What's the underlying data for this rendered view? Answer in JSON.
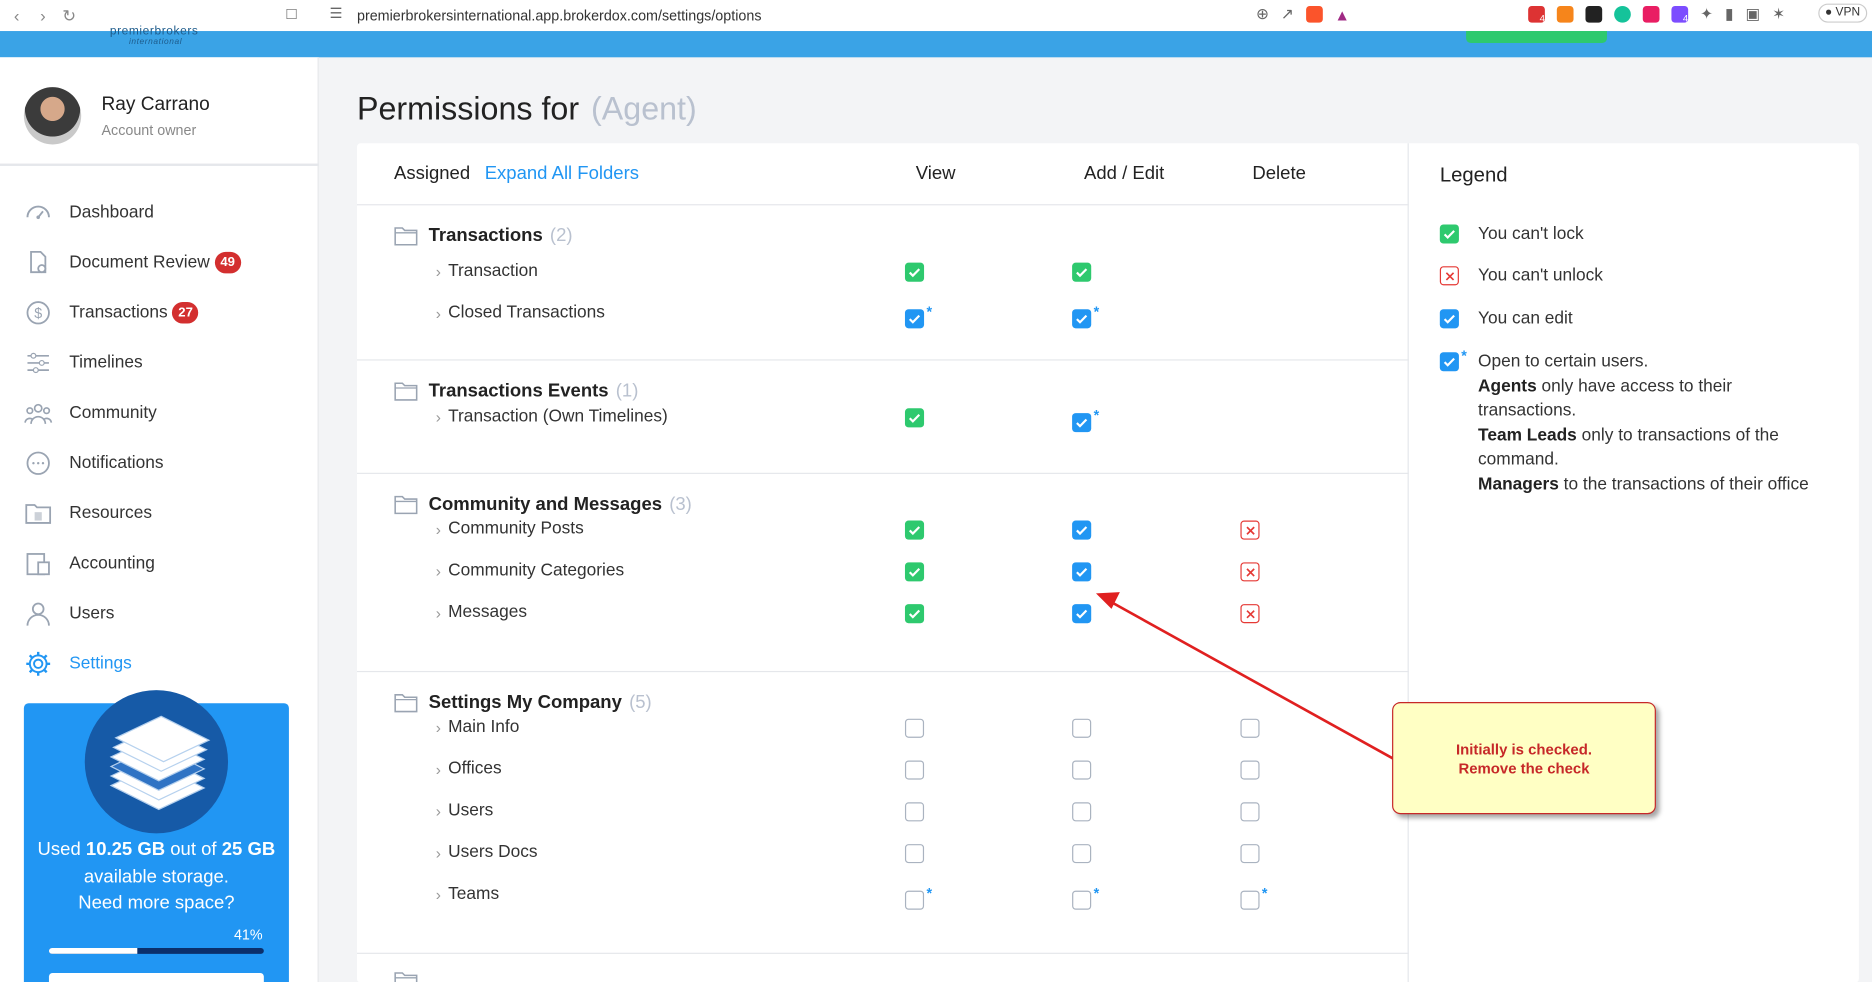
{
  "browser": {
    "url": "premierbrokersinternational.app.brokerdox.com/settings/options",
    "vpn_label": "VPN",
    "ext_badges": [
      "4",
      "4"
    ]
  },
  "brand": {
    "name": "premierbrokers",
    "sub": "international"
  },
  "user": {
    "name": "Ray Carrano",
    "role": "Account owner"
  },
  "sidebar": {
    "items": [
      {
        "label": "Dashboard",
        "icon": "dashboard-icon"
      },
      {
        "label": "Document Review",
        "badge": "49",
        "icon": "document-review-icon"
      },
      {
        "label": "Transactions",
        "badge": "27",
        "icon": "dollar-icon"
      },
      {
        "label": "Timelines",
        "icon": "timelines-icon"
      },
      {
        "label": "Community",
        "icon": "community-icon"
      },
      {
        "label": "Notifications",
        "icon": "chat-bubble-icon"
      },
      {
        "label": "Resources",
        "icon": "folder-icon"
      },
      {
        "label": "Accounting",
        "icon": "accounting-icon"
      },
      {
        "label": "Users",
        "icon": "user-icon"
      },
      {
        "label": "Settings",
        "icon": "gear-icon",
        "active": true
      }
    ]
  },
  "storage": {
    "used_prefix": "Used ",
    "used": "10.25 GB",
    "mid": " out of ",
    "total": "25 GB",
    "suffix": " available storage.",
    "cta": "Need more space?",
    "percent_label": "41%",
    "percent": 41
  },
  "page": {
    "title": "Permissions for",
    "role": "(Agent)"
  },
  "table": {
    "assigned_label": "Assigned",
    "expand_label": "Expand All Folders",
    "columns": [
      "View",
      "Add / Edit",
      "Delete"
    ],
    "folders": [
      {
        "name": "Transactions",
        "count": "(2)",
        "items": [
          {
            "label": "Transaction",
            "view": "green",
            "edit": "green",
            "del": "none"
          },
          {
            "label": "Closed Transactions",
            "view": "blue*",
            "edit": "blue*",
            "del": "none"
          }
        ]
      },
      {
        "name": "Transactions Events",
        "count": "(1)",
        "items": [
          {
            "label": "Transaction (Own Timelines)",
            "view": "green",
            "edit": "blue*",
            "del": "none"
          }
        ]
      },
      {
        "name": "Community and Messages",
        "count": "(3)",
        "items": [
          {
            "label": "Community Posts",
            "view": "green",
            "edit": "blue",
            "del": "redx"
          },
          {
            "label": "Community Categories",
            "view": "green",
            "edit": "blue",
            "del": "redx"
          },
          {
            "label": "Messages",
            "view": "green",
            "edit": "blue",
            "del": "redx"
          }
        ]
      },
      {
        "name": "Settings My Company",
        "count": "(5)",
        "items": [
          {
            "label": "Main Info",
            "view": "empty",
            "edit": "empty",
            "del": "empty"
          },
          {
            "label": "Offices",
            "view": "empty",
            "edit": "empty",
            "del": "empty"
          },
          {
            "label": "Users",
            "view": "empty",
            "edit": "empty",
            "del": "empty"
          },
          {
            "label": "Users Docs",
            "view": "empty",
            "edit": "empty",
            "del": "empty"
          },
          {
            "label": "Teams",
            "view": "empty*",
            "edit": "empty*",
            "del": "empty*"
          }
        ]
      }
    ]
  },
  "legend": {
    "title": "Legend",
    "lock": "You can't lock",
    "unlock": "You can't unlock",
    "edit": "You can edit",
    "open_intro": "Open to certain users.",
    "agents_b": "Agents",
    "agents_t": " only have access to their transactions.",
    "leads_b": "Team Leads",
    "leads_t": " only to transactions of the command.",
    "managers_b": "Managers",
    "managers_t": " to the transactions of their office"
  },
  "callout": {
    "line1": "Initially is checked.",
    "line2": "Remove the check"
  },
  "colors": {
    "accent": "#2196f3",
    "green": "#2ec96e",
    "red": "#e53935",
    "topbar": "#3aa3e6"
  }
}
